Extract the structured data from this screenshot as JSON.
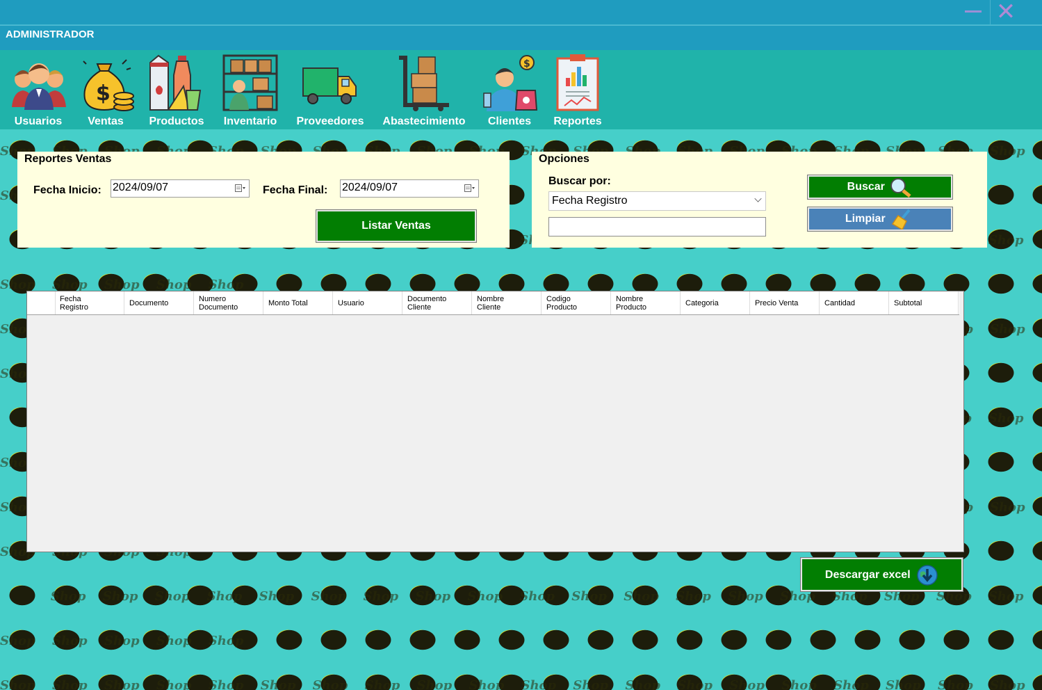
{
  "window": {
    "user_role": "ADMINISTRADOR",
    "minimize_icon": "minimize-icon",
    "close_icon": "close-icon",
    "accent_titlebar": "#1f9cbf",
    "accent_menubar": "#20b3aa"
  },
  "menu": {
    "items": [
      {
        "label": "Usuarios",
        "icon": "users-icon"
      },
      {
        "label": "Ventas",
        "icon": "money-bag-icon"
      },
      {
        "label": "Productos",
        "icon": "groceries-icon"
      },
      {
        "label": "Inventario",
        "icon": "inventory-icon"
      },
      {
        "label": "Proveedores",
        "icon": "delivery-truck-icon"
      },
      {
        "label": "Abastecimiento",
        "icon": "hand-truck-icon"
      },
      {
        "label": "Clientes",
        "icon": "customer-icon"
      },
      {
        "label": "Reportes",
        "icon": "report-clipboard-icon"
      }
    ]
  },
  "report_panel": {
    "title": "Reportes Ventas",
    "start_label": "Fecha Inicio:",
    "start_value": "2024/09/07",
    "end_label": "Fecha Final:",
    "end_value": "2024/09/07",
    "list_button": "Listar Ventas"
  },
  "options_panel": {
    "title": "Opciones",
    "search_by_label": "Buscar por:",
    "search_by_value": "Fecha Registro",
    "search_value": "",
    "search_button": "Buscar",
    "clear_button": "Limpiar"
  },
  "grid": {
    "columns": [
      [
        "Fecha",
        "Registro"
      ],
      [
        "Documento"
      ],
      [
        "Numero",
        "Documento"
      ],
      [
        "Monto Total"
      ],
      [
        "Usuario"
      ],
      [
        "Documento",
        "Cliente"
      ],
      [
        "Nombre",
        "Cliente"
      ],
      [
        "Codigo",
        "Producto"
      ],
      [
        "Nombre",
        "Producto"
      ],
      [
        "Categoria"
      ],
      [
        "Precio Venta"
      ],
      [
        "Cantidad"
      ],
      [
        "Subtotal"
      ]
    ],
    "rows": []
  },
  "download_button": "Descargar excel",
  "pattern_text": "Shop"
}
